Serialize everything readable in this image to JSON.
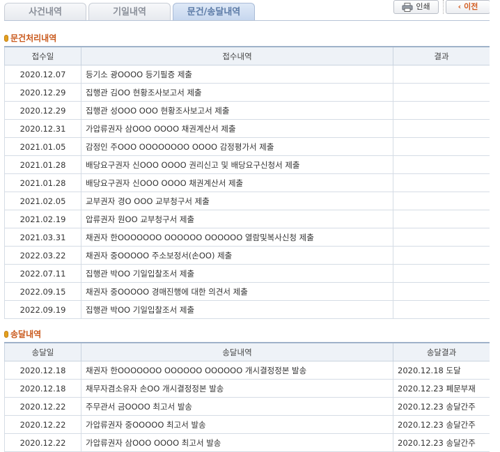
{
  "tabs": [
    {
      "label": "사건내역",
      "active": false
    },
    {
      "label": "기일내역",
      "active": false
    },
    {
      "label": "문건/송달내역",
      "active": true
    }
  ],
  "toolbar": {
    "print_label": "인쇄",
    "prev_label": "이전"
  },
  "documents": {
    "title": "문건처리내역",
    "headers": [
      "접수일",
      "접수내역",
      "결과"
    ],
    "rows": [
      [
        "2020.12.07",
        "등기소 광OOOO 등기필증 제출",
        ""
      ],
      [
        "2020.12.29",
        "집행관 김OO 현황조사보고서 제출",
        ""
      ],
      [
        "2020.12.29",
        "집행관 성OOO OOO 현황조사보고서 제출",
        ""
      ],
      [
        "2020.12.31",
        "가압류권자 삼OOO OOOO 채권계산서 제출",
        ""
      ],
      [
        "2021.01.05",
        "감정인 주OOO OOOOOOOO OOOO 감정평가서 제출",
        ""
      ],
      [
        "2021.01.28",
        "배당요구권자 신OOO OOOO 권리신고 및 배당요구신청서 제출",
        ""
      ],
      [
        "2021.01.28",
        "배당요구권자 신OOO OOOO 채권계산서 제출",
        ""
      ],
      [
        "2021.02.05",
        "교부권자 경O OOO 교부청구서 제출",
        ""
      ],
      [
        "2021.02.19",
        "압류권자 원OO 교부청구서 제출",
        ""
      ],
      [
        "2021.03.31",
        "채권자 한OOOOOOO OOOOOO OOOOOO 열람및복사신청 제출",
        ""
      ],
      [
        "2022.03.22",
        "채권자 중OOOOO 주소보정서(손OO) 제출",
        ""
      ],
      [
        "2022.07.11",
        "집행관 박OO 기일입찰조서 제출",
        ""
      ],
      [
        "2022.09.15",
        "채권자 중OOOOO 경매진행에 대한 의견서 제출",
        ""
      ],
      [
        "2022.09.19",
        "집행관 박OO 기일입찰조서 제출",
        ""
      ]
    ]
  },
  "deliveries": {
    "title": "송달내역",
    "headers": [
      "송달일",
      "송달내역",
      "송달결과"
    ],
    "rows": [
      [
        "2020.12.18",
        "채권자 한OOOOOOO OOOOOO OOOOOO 개시결정정본 발송",
        "2020.12.18 도달"
      ],
      [
        "2020.12.18",
        "채무자겸소유자 손OO 개시결정정본 발송",
        "2020.12.23 폐문부재"
      ],
      [
        "2020.12.22",
        "주무관서 금OOOO 최고서 발송",
        "2020.12.23 송달간주"
      ],
      [
        "2020.12.22",
        "가압류권자 중OOOOO 최고서 발송",
        "2020.12.23 송달간주"
      ],
      [
        "2020.12.22",
        "가압류권자 삼OOO OOOO 최고서 발송",
        "2020.12.23 송달간주"
      ]
    ]
  }
}
